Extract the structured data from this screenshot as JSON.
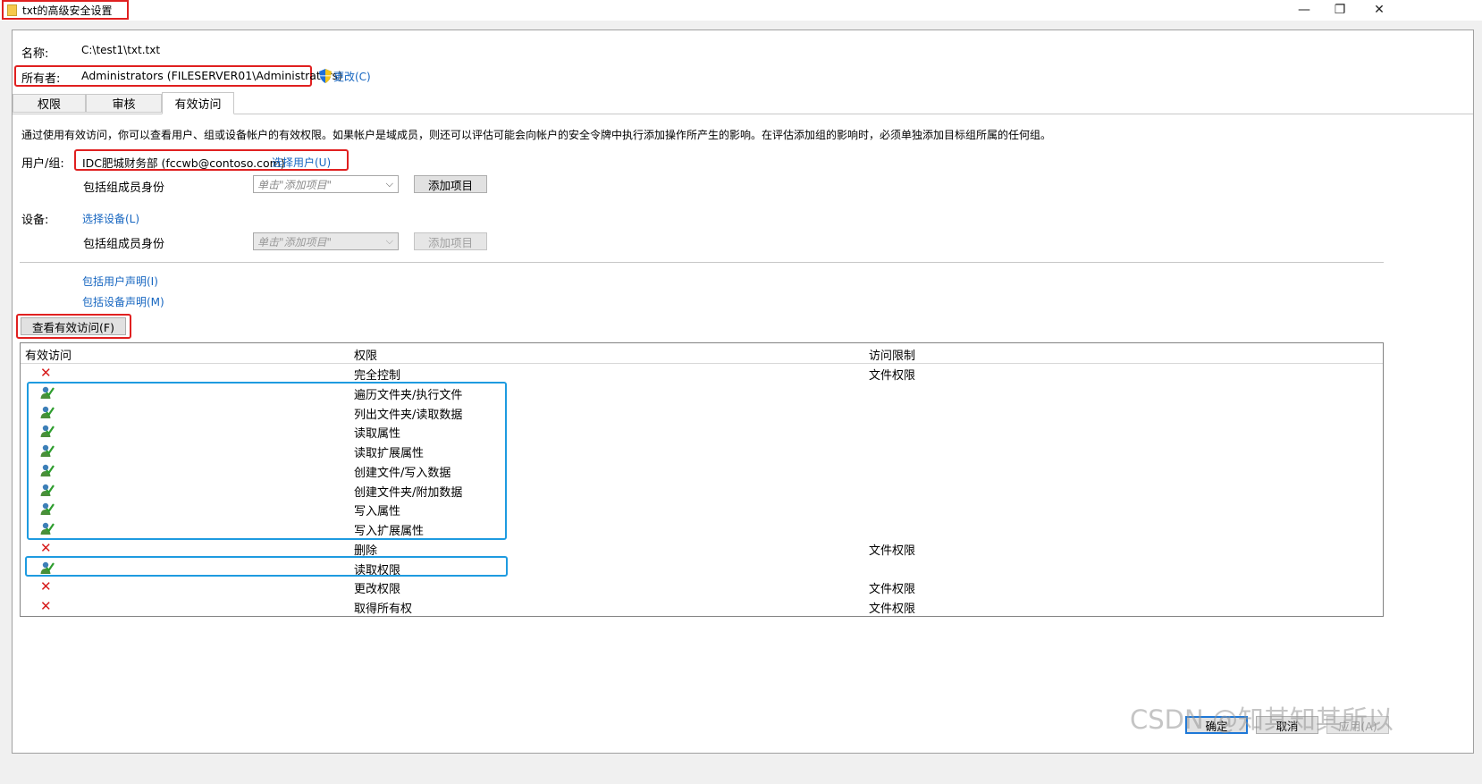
{
  "window": {
    "title": "txt的高级安全设置",
    "minimize_glyph": "—",
    "restore_glyph": "❐",
    "close_glyph": "✕"
  },
  "info": {
    "name_label": "名称:",
    "name_value": "C:\\test1\\txt.txt",
    "owner_label": "所有者:",
    "owner_value": "Administrators (FILESERVER01\\Administrators)",
    "change_link": "更改(C)"
  },
  "tabs": [
    {
      "label": "权限",
      "active": false
    },
    {
      "label": "审核",
      "active": false
    },
    {
      "label": "有效访问",
      "active": true
    }
  ],
  "description": "通过使用有效访问，你可以查看用户、组或设备帐户的有效权限。如果帐户是域成员，则还可以评估可能会向帐户的安全令牌中执行添加操作所产生的影响。在评估添加组的影响时，必须单独添加目标组所属的任何组。",
  "user_group": {
    "label": "用户/组:",
    "value": "IDC肥城财务部 (fccwb@contoso.com)",
    "select_link": "选择用户(U)",
    "include_label": "包括组成员身份",
    "combo_placeholder": "单击\"添加项目\"",
    "add_button": "添加项目"
  },
  "device": {
    "label": "设备:",
    "select_link": "选择设备(L)",
    "include_label": "包括组成员身份",
    "combo_placeholder": "单击\"添加项目\"",
    "add_button": "添加项目"
  },
  "claims": {
    "user_claim_link": "包括用户声明(I)",
    "device_claim_link": "包括设备声明(M)"
  },
  "view_button": "查看有效访问(F)",
  "table": {
    "headers": [
      "有效访问",
      "权限",
      "访问限制"
    ],
    "rows": [
      {
        "access": "denied",
        "permission": "完全控制",
        "limit": "文件权限"
      },
      {
        "access": "allowed",
        "permission": "遍历文件夹/执行文件",
        "limit": ""
      },
      {
        "access": "allowed",
        "permission": "列出文件夹/读取数据",
        "limit": ""
      },
      {
        "access": "allowed",
        "permission": "读取属性",
        "limit": ""
      },
      {
        "access": "allowed",
        "permission": "读取扩展属性",
        "limit": ""
      },
      {
        "access": "allowed",
        "permission": "创建文件/写入数据",
        "limit": ""
      },
      {
        "access": "allowed",
        "permission": "创建文件夹/附加数据",
        "limit": ""
      },
      {
        "access": "allowed",
        "permission": "写入属性",
        "limit": ""
      },
      {
        "access": "allowed",
        "permission": "写入扩展属性",
        "limit": ""
      },
      {
        "access": "denied",
        "permission": "删除",
        "limit": "文件权限"
      },
      {
        "access": "allowed",
        "permission": "读取权限",
        "limit": ""
      },
      {
        "access": "denied",
        "permission": "更改权限",
        "limit": "文件权限"
      },
      {
        "access": "denied",
        "permission": "取得所有权",
        "limit": "文件权限"
      }
    ]
  },
  "footer": {
    "ok": "确定",
    "cancel": "取消",
    "apply": "应用(A)"
  },
  "watermark": "CSDN @知其知其所以",
  "icons": {
    "allowed": "user-check-icon",
    "denied": "red-x-icon",
    "owner_change": "uac-shield-icon",
    "title": "folder-icon"
  },
  "colors": {
    "highlight_red": "#e02020",
    "highlight_blue": "#1e9be0",
    "link": "#1565c0",
    "deny": "#d61a1a"
  }
}
